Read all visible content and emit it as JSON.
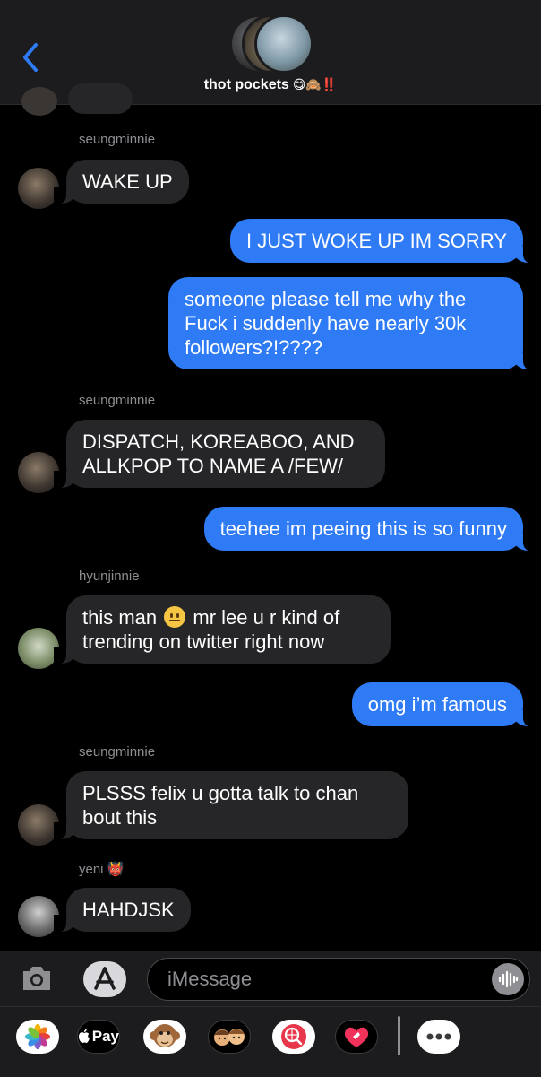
{
  "header": {
    "group_name": "thot pockets",
    "title_emoji": "😋🙈‼️",
    "back_icon": "chevron-left-icon"
  },
  "messages": [
    {
      "type": "sender",
      "text": "seungminnie"
    },
    {
      "type": "in",
      "text": "WAKE UP"
    },
    {
      "type": "out",
      "text": "I JUST WOKE UP IM SORRY"
    },
    {
      "type": "out",
      "text": "someone please tell me why the Fuck i suddenly have nearly 30k followers?!????"
    },
    {
      "type": "sender",
      "text": "seungminnie"
    },
    {
      "type": "in",
      "text": "DISPATCH, KOREABOO, AND ALLKPOP TO NAME A /FEW/"
    },
    {
      "type": "out",
      "text": "teehee im peeing this is so funny"
    },
    {
      "type": "sender",
      "text": "hyunjinnie"
    },
    {
      "type": "in",
      "text_before": "this man",
      "text_after": "mr lee u r kind of trending on twitter right now"
    },
    {
      "type": "out",
      "text": "omg i’m famous"
    },
    {
      "type": "sender",
      "text": "seungminnie"
    },
    {
      "type": "in",
      "text": "PLSSS felix u gotta talk to chan bout this"
    },
    {
      "type": "sender",
      "text": "yeni 👹"
    },
    {
      "type": "in",
      "text": "HAHDJSK"
    }
  ],
  "input": {
    "placeholder": "iMessage"
  },
  "app_drawer": {
    "apple_pay_label": "Pay"
  },
  "colors": {
    "outgoing_bubble": "#2f7bf5",
    "incoming_bubble": "#262628",
    "background": "#000000",
    "bar": "#1c1c1e"
  }
}
